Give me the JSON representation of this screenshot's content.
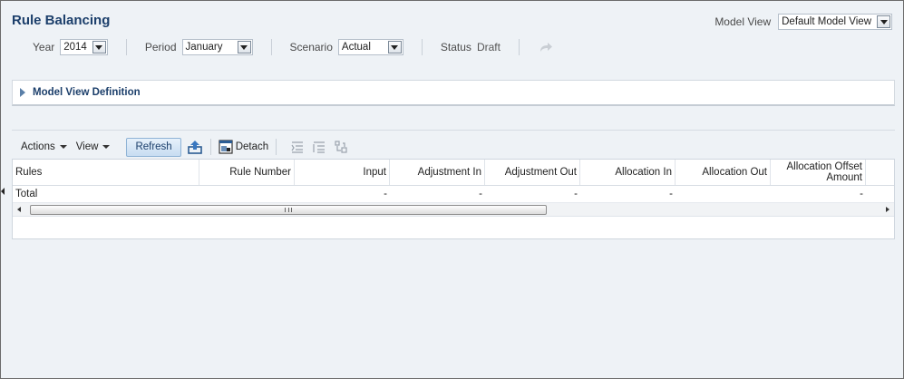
{
  "page": {
    "title": "Rule Balancing"
  },
  "model_view": {
    "label": "Model View",
    "value": "Default Model View"
  },
  "pov": {
    "year_label": "Year",
    "year_value": "2014",
    "period_label": "Period",
    "period_value": "January",
    "scenario_label": "Scenario",
    "scenario_value": "Actual",
    "status_label": "Status",
    "status_value": "Draft"
  },
  "accordion": {
    "title": "Model View Definition"
  },
  "toolbar": {
    "actions_label": "Actions",
    "view_label": "View",
    "refresh_label": "Refresh",
    "detach_label": "Detach"
  },
  "table": {
    "columns": [
      "Rules",
      "Rule Number",
      "Input",
      "Adjustment In",
      "Adjustment Out",
      "Allocation In",
      "Allocation Out",
      "Allocation Offset Amount"
    ],
    "rows": [
      [
        "Total",
        "",
        "-",
        "-",
        "-",
        "-",
        "",
        "-"
      ]
    ]
  },
  "colors": {
    "title": "#1c3f6b",
    "background": "#eef2f6",
    "accent": "#8fb3d6"
  },
  "icons": [
    "redo-icon",
    "upload-icon",
    "detach-icon",
    "expand-all-icon",
    "collapse-all-icon",
    "pivot-icon"
  ]
}
